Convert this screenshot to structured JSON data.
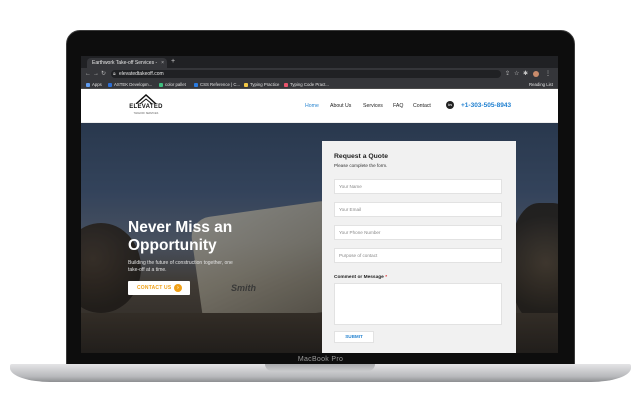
{
  "device": {
    "model_label": "MacBook Pro"
  },
  "browser": {
    "tab_title": "Earthwork Take-off Services -",
    "tab_close": "×",
    "new_tab": "+",
    "url": "elevatedtakeoff.com",
    "nav_icons": {
      "back": "←",
      "forward": "→",
      "reload": "↻"
    },
    "right_icons": {
      "share": "⇪",
      "star": "☆",
      "extensions": "✱",
      "menu": "⋮"
    },
    "bookmarks": [
      {
        "label": "Apps",
        "color": "#5f9cf0"
      },
      {
        "label": "ASTEK Developm...",
        "color": "#2d6fd6"
      },
      {
        "label": "color pallet",
        "color": "#3fbf7f"
      },
      {
        "label": "CSS Reference | C...",
        "color": "#2a7be0"
      },
      {
        "label": "Typing Practice",
        "color": "#f2c744"
      },
      {
        "label": "Typing Code Pract...",
        "color": "#e9546b"
      }
    ],
    "reading_list": "Reading List"
  },
  "site": {
    "logo_text": "ELEVATED",
    "logo_sub": "TAKEOFF SERVICES",
    "nav": [
      "Home",
      "About Us",
      "Services",
      "FAQ",
      "Contact"
    ],
    "linkedin_icon": "in",
    "phone": "+1-303-505-8943",
    "hero": {
      "title": "Never Miss an Opportunity",
      "subtitle": "Building the future of construction together, one take-off at a time.",
      "cta_label": "CONTACT US",
      "cta_arrow": "›",
      "machine_brand": "Smith"
    },
    "form": {
      "title": "Request a Quote",
      "subtitle": "Please complete the form.",
      "fields": {
        "name": "Your Name",
        "email": "Your Email",
        "phone": "Your Phone Number",
        "purpose": "Purpose of contact"
      },
      "comment_label": "Comment or Message",
      "required_mark": "*",
      "submit": "SUBMIT"
    }
  },
  "colors": {
    "accent_blue": "#2a86d1",
    "cta_orange": "#f0a016"
  }
}
